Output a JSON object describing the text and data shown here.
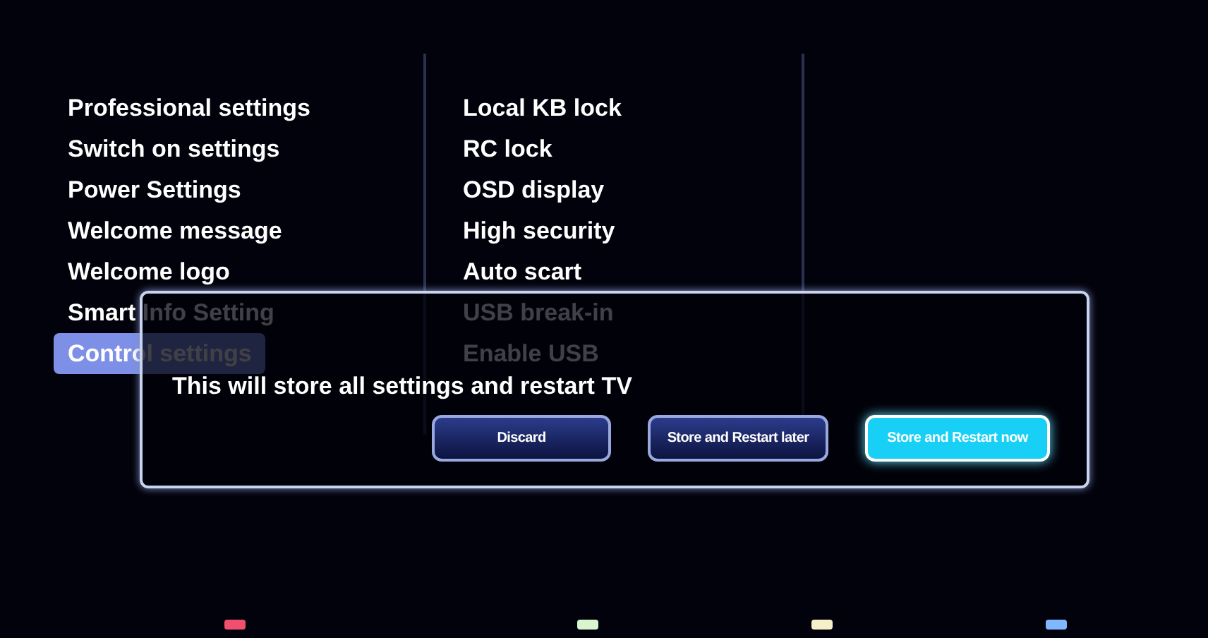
{
  "menu": {
    "items": [
      {
        "label": "Professional settings",
        "selected": false
      },
      {
        "label": "Switch on settings",
        "selected": false
      },
      {
        "label": "Power Settings",
        "selected": false
      },
      {
        "label": "Welcome message",
        "selected": false
      },
      {
        "label": "Welcome logo",
        "selected": false
      },
      {
        "label": "Smart Info Setting",
        "selected": false
      },
      {
        "label": "Control settings",
        "selected": true
      }
    ]
  },
  "submenu": {
    "items": [
      "Local KB lock",
      "RC lock",
      "OSD display",
      "High security",
      "Auto scart",
      "USB break-in",
      "Enable USB"
    ]
  },
  "dialog": {
    "message": "This will store all settings and restart TV",
    "buttons": [
      {
        "label": "Discard",
        "selected": false
      },
      {
        "label": "Store and Restart later",
        "selected": false
      },
      {
        "label": "Store and Restart now",
        "selected": true
      }
    ]
  },
  "color_keys": [
    {
      "color": "#f0506e"
    },
    {
      "color": "#d8f5d0"
    },
    {
      "color": "#f5f0c8"
    },
    {
      "color": "#80b8ff"
    }
  ]
}
